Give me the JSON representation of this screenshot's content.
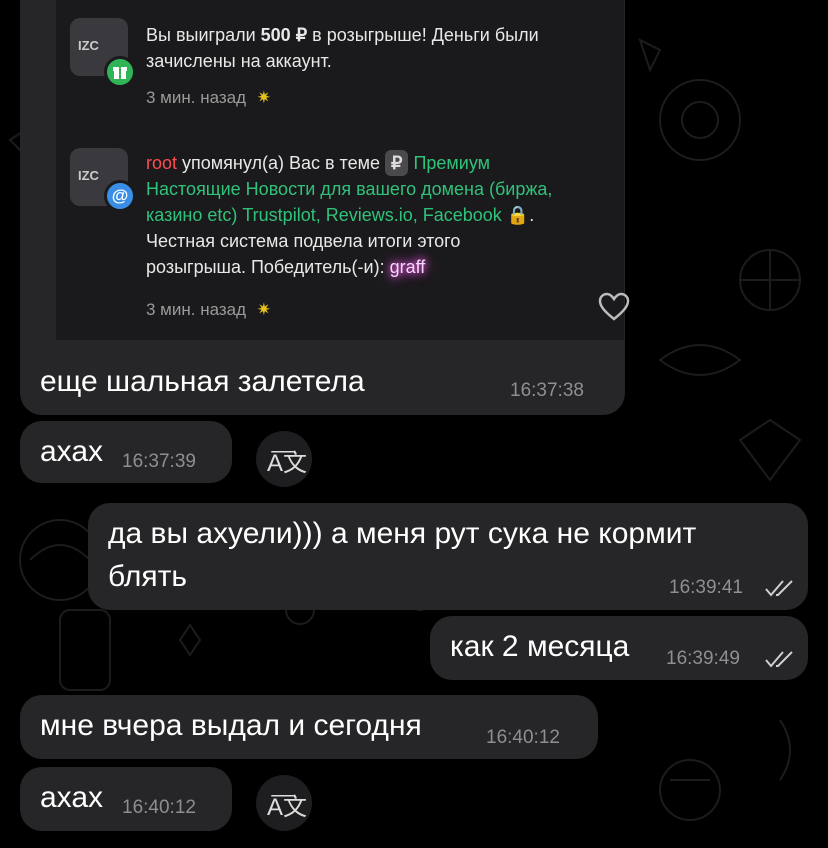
{
  "notifications": [
    {
      "text_part1": "Вы выиграли ",
      "amount": "500 ₽",
      "text_part2": " в розыгрыше! Деньги были",
      "text_line2": "зачислены на аккаунт.",
      "time": "3 мин. назад",
      "badge_icon": "gift-icon",
      "avatar_label": "IZC"
    },
    {
      "user": "root",
      "text_mention": " упомянул(а) Вас в теме ",
      "prefix_badge": "₽",
      "prefix_label": "Премиум",
      "thread_line1": "Настоящие Новости для вашего домена (биржа,",
      "thread_line2": "казино etc) Trustpilot, Reviews.io, Facebook",
      "body_line1": "Честная система подвела итоги этого",
      "body_line2": "розыгрыша. Победитель(-и):",
      "winner": "graff",
      "time": "3 мин. назад",
      "badge_icon": "at-icon",
      "avatar_label": "IZC"
    }
  ],
  "messages": [
    {
      "text": "еще шальная залетела",
      "time": "16:37:38",
      "direction": "in"
    },
    {
      "text": "ахах",
      "time": "16:37:39",
      "direction": "in",
      "translate": true
    },
    {
      "text_line1": "да вы ахуели))) а меня рут сука не кормит",
      "text_line2": "блять",
      "time": "16:39:41",
      "direction": "out",
      "read": true
    },
    {
      "text": "как 2 месяца",
      "time": "16:39:49",
      "direction": "out",
      "read": true
    },
    {
      "text": "мне вчера выдал и сегодня",
      "time": "16:40:12",
      "direction": "in"
    },
    {
      "text": "ахах",
      "time": "16:40:12",
      "direction": "in",
      "translate": true
    }
  ],
  "colors": {
    "bubble": "#262628",
    "background": "#000000",
    "accent_green": "#30c27a",
    "mention_red": "#ff4d4d"
  }
}
